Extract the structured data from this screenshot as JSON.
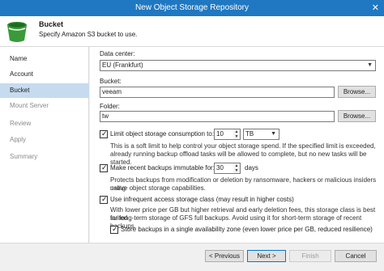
{
  "window": {
    "title": "New Object Storage Repository",
    "close_glyph": "✕"
  },
  "header": {
    "title": "Bucket",
    "subtitle": "Specify Amazon S3 bucket to use."
  },
  "nav": [
    {
      "label": "Name",
      "state": "done"
    },
    {
      "label": "Account",
      "state": "done"
    },
    {
      "label": "Bucket",
      "state": "active"
    },
    {
      "label": "Mount Server",
      "state": "pending"
    },
    {
      "label": "Review",
      "state": "pending"
    },
    {
      "label": "Apply",
      "state": "pending"
    },
    {
      "label": "Summary",
      "state": "pending"
    }
  ],
  "form": {
    "datacenter_label": "Data center:",
    "datacenter_value": "EU (Frankfurt)",
    "bucket_label": "Bucket:",
    "bucket_value": "veeam",
    "browse_label": "Browse...",
    "folder_label": "Folder:",
    "folder_value": "tw",
    "limit": {
      "label": "Limit object storage consumption to:",
      "checked": true,
      "value": "10",
      "unit": "TB",
      "desc1": "This is a soft limit to help control your object storage spend. If the specified limit is exceeded,",
      "desc2": "already running backup offload tasks will be allowed to complete, but no new tasks will be started."
    },
    "immutable": {
      "label": "Make recent backups immutable for:",
      "checked": true,
      "value": "30",
      "unit": "days",
      "desc1": "Protects backups from modification or deletion by ransomware, hackers or malicious insiders using",
      "desc2": "native object storage capabilities."
    },
    "infrequent": {
      "label": "Use infrequent access storage class (may result in higher costs)",
      "checked": true,
      "desc1": "With lower price per GB but higher retrieval and early deletion fees, this storage class is best suited",
      "desc2": "for long-term storage of GFS full backups. Avoid using it for short-term storage of recent backups."
    },
    "single_zone": {
      "label": "Store backups in a single availability zone (even lower price per GB, reduced resilience)",
      "checked": true
    }
  },
  "footer": {
    "previous_label": "< Previous",
    "next_label": "Next >",
    "finish_label": "Finish",
    "cancel_label": "Cancel"
  },
  "icons": {
    "bucket": "bucket-icon",
    "check": "✓",
    "dropdown": "▼",
    "spin_up": "▲",
    "spin_down": "▼"
  },
  "colors": {
    "titlebar": "#1f78c1",
    "nav_active": "#c6dbef",
    "bucket_icon": "#3a9a3a"
  }
}
